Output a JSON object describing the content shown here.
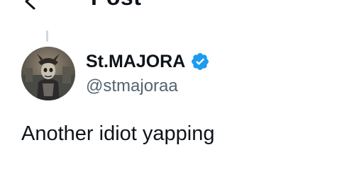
{
  "header": {
    "title": "Post",
    "back_icon": "back-arrow-icon"
  },
  "author": {
    "display_name": "St.MAJORA",
    "handle": "@stmajoraa",
    "verified": true,
    "verified_icon": "verified-badge-icon",
    "verified_color": "#1d9bf0",
    "avatar_icon": "avatar-image"
  },
  "post": {
    "text": "Another idiot yapping"
  },
  "colors": {
    "text_primary": "#0f1419",
    "text_secondary": "#536471",
    "thread_line": "#cfd9de",
    "background": "#ffffff"
  }
}
